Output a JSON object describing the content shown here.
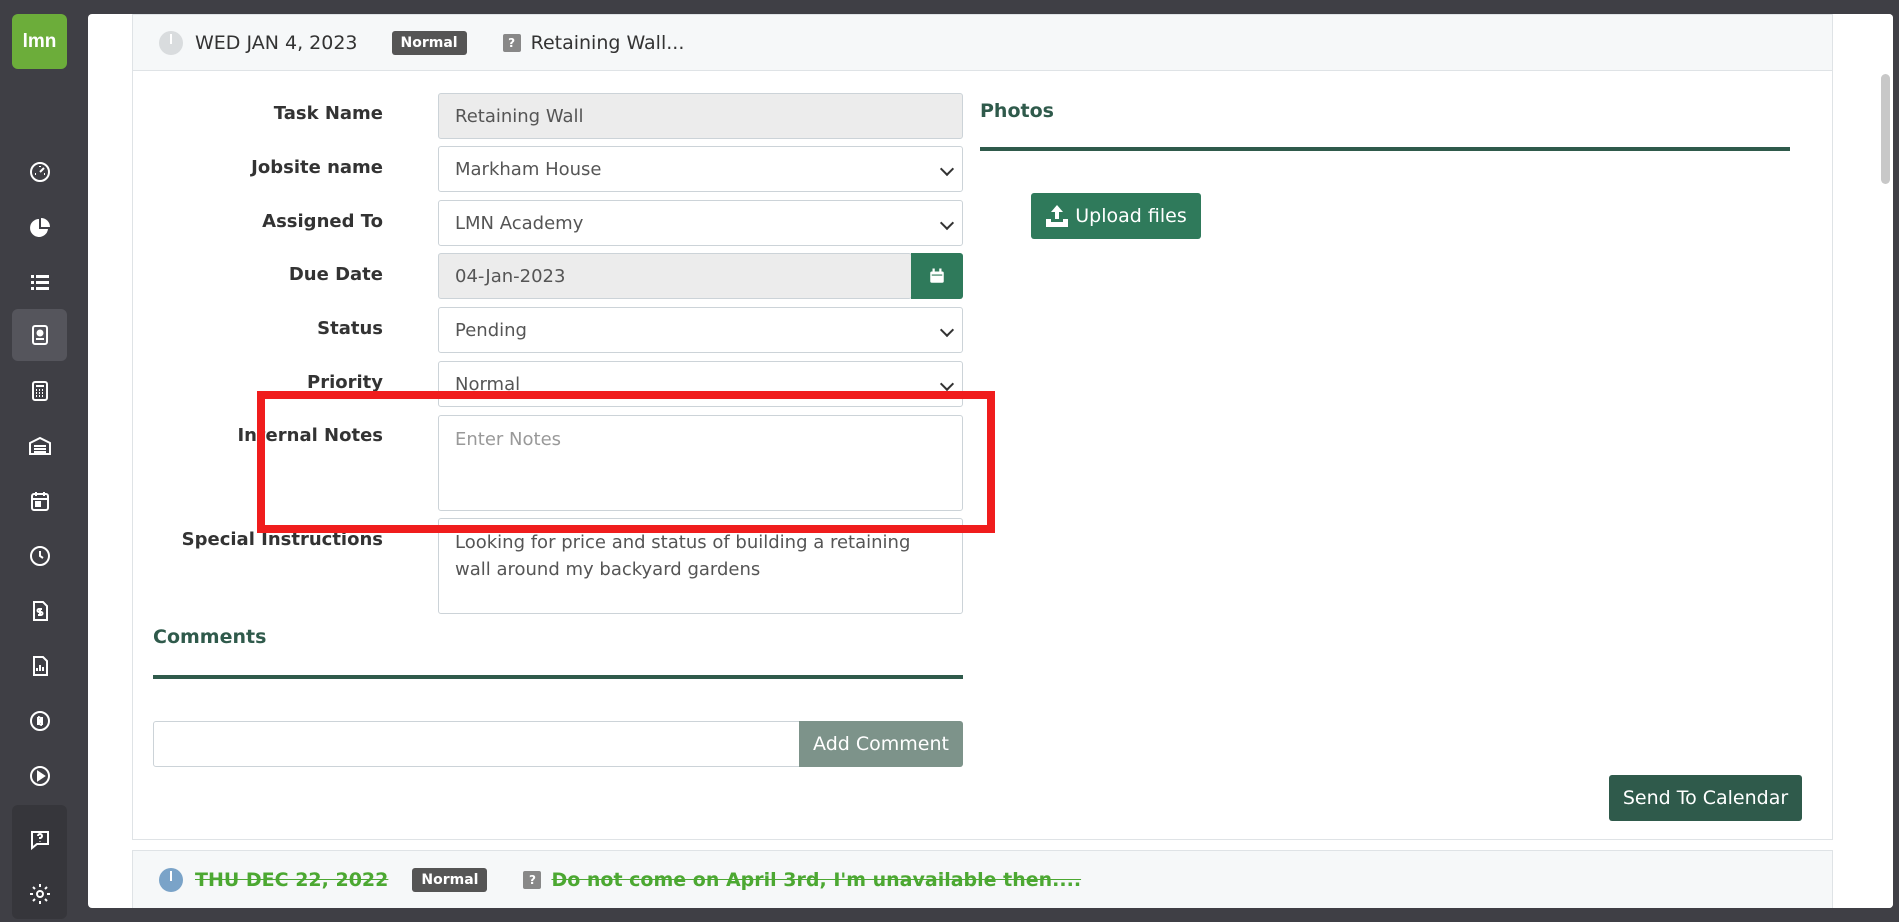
{
  "sidebar": {
    "logo": "lmn",
    "items": [
      {
        "icon": "dashboard-icon"
      },
      {
        "icon": "pie-chart-icon"
      },
      {
        "icon": "list-icon"
      },
      {
        "icon": "contact-card-icon",
        "active": true
      },
      {
        "icon": "calculator-icon"
      },
      {
        "icon": "warehouse-icon"
      },
      {
        "icon": "calendar-icon"
      },
      {
        "icon": "clock-icon"
      },
      {
        "icon": "invoice-icon"
      },
      {
        "icon": "report-icon"
      },
      {
        "icon": "quickbooks-icon"
      },
      {
        "icon": "play-icon"
      },
      {
        "icon": "help-chat-icon"
      },
      {
        "icon": "settings-icon"
      }
    ]
  },
  "task": {
    "date": "WED JAN 4, 2023",
    "priority_badge": "Normal",
    "title": "Retaining Wall..."
  },
  "form": {
    "task_name_label": "Task Name",
    "task_name_value": "Retaining Wall",
    "jobsite_label": "Jobsite name",
    "jobsite_value": "Markham House",
    "assigned_label": "Assigned To",
    "assigned_value": "LMN Academy",
    "due_date_label": "Due Date",
    "due_date_value": "04-Jan-2023",
    "status_label": "Status",
    "status_value": "Pending",
    "priority_label": "Priority",
    "priority_value": "Normal",
    "notes_label": "Internal Notes",
    "notes_placeholder": "Enter Notes",
    "special_label": "Special Instructions",
    "special_value": "Looking for price and status of building a retaining wall around my backyard gardens"
  },
  "photos": {
    "title": "Photos",
    "upload_label": "Upload files"
  },
  "comments": {
    "title": "Comments",
    "add_label": "Add Comment"
  },
  "send_calendar_label": "Send To Calendar",
  "next_task": {
    "date": "THU DEC 22, 2022",
    "priority_badge": "Normal",
    "title": "Do not come on April 3rd, I'm unavailable then...."
  },
  "colors": {
    "brand_green": "#2f7a5b",
    "dark_green": "#2f5a4b",
    "logo_green": "#6cad3a",
    "highlight_red": "#f01d1d",
    "done_green": "#4ca832"
  }
}
